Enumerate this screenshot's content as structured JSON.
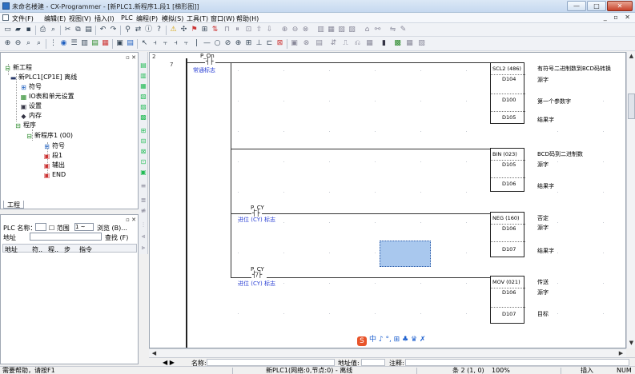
{
  "window": {
    "title": "未命名楼建 - CX-Programmer - [新PLC1.新程序1.段1 [梯形图]]",
    "minimize": "—",
    "maximize": "□",
    "close": "✕"
  },
  "menu": [
    {
      "label": "文件(F)"
    },
    {
      "label": "编辑(E)"
    },
    {
      "label": "视图(V)"
    },
    {
      "label": "插入(I)"
    },
    {
      "label": "PLC"
    },
    {
      "label": "编程(P)"
    },
    {
      "label": "模拟(S)"
    },
    {
      "label": "工具(T)"
    },
    {
      "label": "窗口(W)"
    },
    {
      "label": "帮助(H)"
    }
  ],
  "mdi_buttons": "_ ▫ ✕",
  "project_tree": {
    "tab": "工程",
    "items": [
      {
        "label": "新工程",
        "icon": "project-icon"
      },
      {
        "label": "新PLC1[CP1E] 离线",
        "icon": "plc-icon"
      },
      {
        "label": "符号",
        "icon": "symbols-icon"
      },
      {
        "label": "IO表和单元设置",
        "icon": "io-table-icon"
      },
      {
        "label": "设置",
        "icon": "settings-icon"
      },
      {
        "label": "内存",
        "icon": "memory-icon"
      },
      {
        "label": "程序",
        "icon": "programs-icon"
      },
      {
        "label": "新程序1 (00)",
        "icon": "program-icon"
      },
      {
        "label": "符号",
        "icon": "symbols-icon"
      },
      {
        "label": "段1",
        "icon": "section-icon"
      },
      {
        "label": "辅出",
        "icon": "section-icon"
      },
      {
        "label": "END",
        "icon": "section-icon"
      }
    ]
  },
  "address_panel": {
    "plc_label": "PLC 名称：",
    "range_label": "范围",
    "range_value": "1 ~",
    "browse_button": "浏览 (B)...",
    "address_label": "地址",
    "find_button": "查找 (F)",
    "columns": [
      "地址",
      "符..",
      "程..",
      "步",
      "指令"
    ]
  },
  "ladder": {
    "rung_numbers": [
      "2",
      "7"
    ],
    "contacts": [
      {
        "name": "P_On",
        "comment": "常通标志"
      },
      {
        "name": "P_CY",
        "comment": "进位 (CY) 标志"
      },
      {
        "name": "P_CY",
        "comment": "进位 (CY) 标志"
      }
    ],
    "instructions": [
      {
        "name": "SCL2 (486)",
        "operands": [
          "D104",
          "D100",
          "D105"
        ],
        "comments": [
          "有符号二进制数到BCD码转换",
          "源字",
          "第一个参数字",
          "结果字"
        ]
      },
      {
        "name": "BIN (023)",
        "operands": [
          "D105",
          "D106"
        ],
        "comments": [
          "BCD码到二进制数",
          "源字",
          "结果字"
        ]
      },
      {
        "name": "NEG (160)",
        "operands": [
          "D106",
          "D107"
        ],
        "comments": [
          "否定",
          "源字",
          "结果字"
        ]
      },
      {
        "name": "MOV (021)",
        "operands": [
          "D106",
          "D107"
        ],
        "comments": [
          "传送",
          "源字",
          "目标"
        ]
      }
    ]
  },
  "ime_toolbar": {
    "logo": "S",
    "text": "中 ♪ °, ⊞ ♣ ♛ ✗"
  },
  "bottom_fields": {
    "name_label": "名称:",
    "address_label": "地址值:",
    "comment_label": "注释:"
  },
  "status": {
    "help": "需要帮助，请按F1",
    "plc_info": "新PLC1(网络:0,节点:0) - 离线",
    "position": "条 2 (1, 0)",
    "zoom": "100%",
    "mode": "插入",
    "numlock": "NUM"
  }
}
